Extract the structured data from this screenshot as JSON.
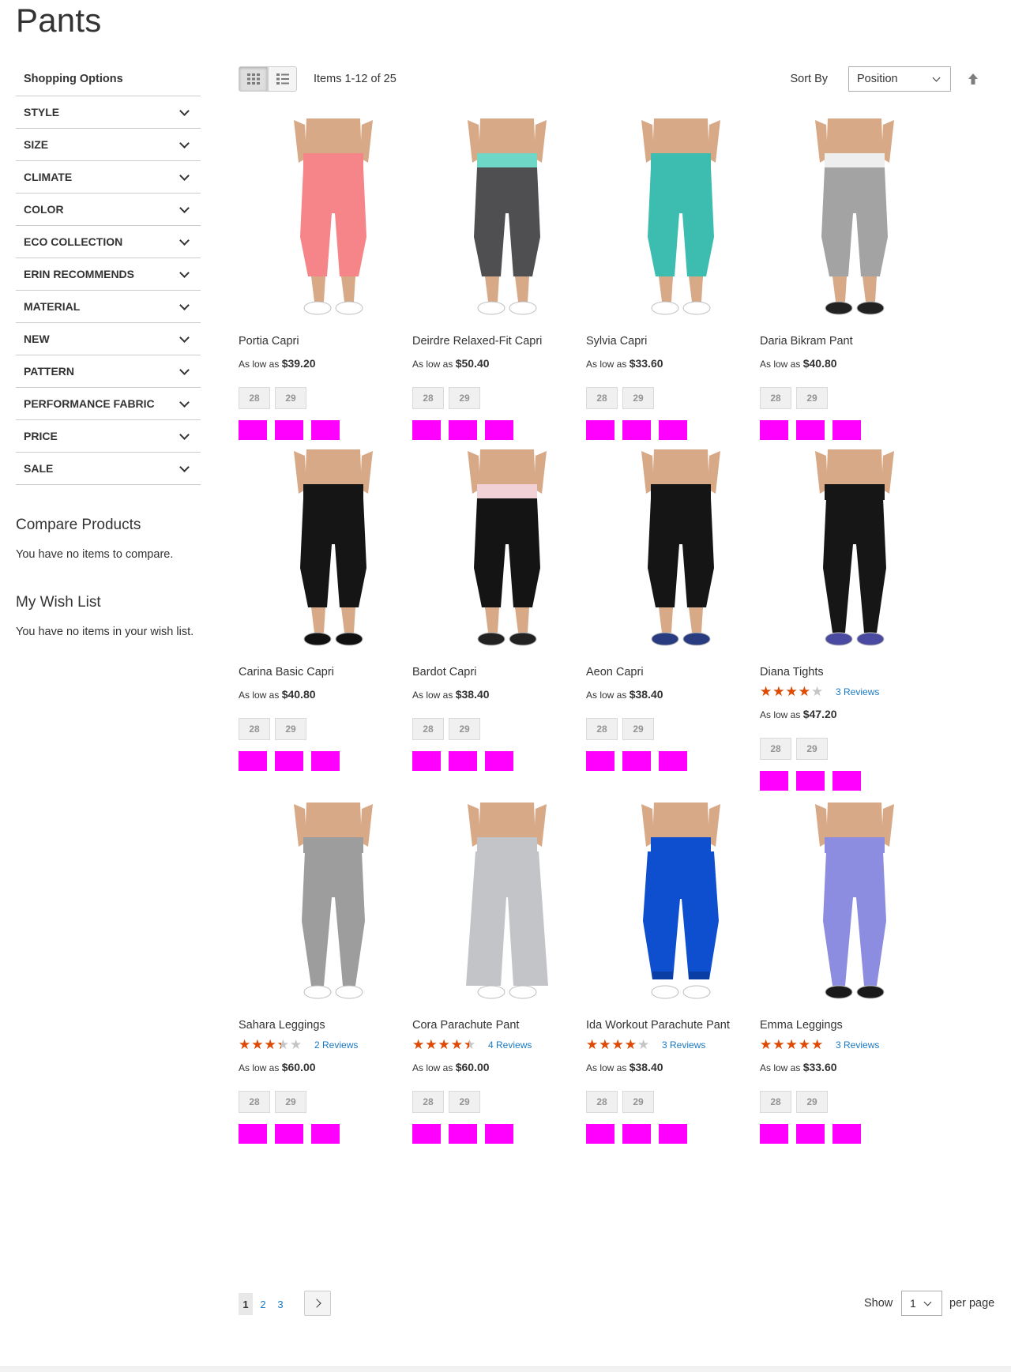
{
  "page_title": "Pants",
  "sidebar": {
    "title": "Shopping Options",
    "filters": [
      "STYLE",
      "SIZE",
      "CLIMATE",
      "COLOR",
      "ECO COLLECTION",
      "ERIN RECOMMENDS",
      "MATERIAL",
      "NEW",
      "PATTERN",
      "PERFORMANCE FABRIC",
      "PRICE",
      "SALE"
    ],
    "compare_title": "Compare Products",
    "compare_text": "You have no items to compare.",
    "wishlist_title": "My Wish List",
    "wishlist_text": "You have no items in your wish list."
  },
  "toolbar": {
    "amount": "Items 1-12 of 25",
    "sort_label": "Sort By",
    "sort_value": "Position"
  },
  "products": [
    {
      "name": "Portia Capri",
      "price_prefix": "As low as",
      "price": "$39.20",
      "sizes": [
        "28",
        "29"
      ],
      "pant": "#f6858a",
      "waist": "#f6858a",
      "shape": "capri",
      "shoe": "#ffffff"
    },
    {
      "name": "Deirdre Relaxed-Fit Capri",
      "price_prefix": "As low as",
      "price": "$50.40",
      "sizes": [
        "28",
        "29"
      ],
      "pant": "#4f4f52",
      "waist": "#6fd7c5",
      "shape": "capri",
      "shoe": "#ffffff"
    },
    {
      "name": "Sylvia Capri",
      "price_prefix": "As low as",
      "price": "$33.60",
      "sizes": [
        "28",
        "29"
      ],
      "pant": "#3cbdb0",
      "waist": "#3cbdb0",
      "shape": "capri",
      "shoe": "#ffffff"
    },
    {
      "name": "Daria Bikram Pant",
      "price_prefix": "As low as",
      "price": "$40.80",
      "sizes": [
        "28",
        "29"
      ],
      "pant": "#a3a3a3",
      "waist": "#eeeeee",
      "shape": "capri",
      "shoe": "#222222"
    },
    {
      "name": "Carina Basic Capri",
      "price_prefix": "As low as",
      "price": "$40.80",
      "sizes": [
        "28",
        "29"
      ],
      "pant": "#151515",
      "waist": "#151515",
      "shape": "capri",
      "shoe": "#111111"
    },
    {
      "name": "Bardot Capri",
      "price_prefix": "As low as",
      "price": "$38.40",
      "sizes": [
        "28",
        "29"
      ],
      "pant": "#141414",
      "waist": "#f1d0d6",
      "shape": "capri",
      "shoe": "#222222"
    },
    {
      "name": "Aeon Capri",
      "price_prefix": "As low as",
      "price": "$38.40",
      "sizes": [
        "28",
        "29"
      ],
      "pant": "#151515",
      "waist": "#151515",
      "shape": "capri",
      "shoe": "#2a3c80"
    },
    {
      "name": "Diana Tights",
      "rating": 3.5,
      "reviews": "3 Reviews",
      "price_prefix": "As low as",
      "price": "$47.20",
      "sizes": [
        "28",
        "29"
      ],
      "pant": "#161616",
      "waist": "#161616",
      "shape": "full",
      "shoe": "#4a4aa0"
    },
    {
      "name": "Sahara Leggings",
      "rating": 3,
      "reviews": "2 Reviews",
      "price_prefix": "As low as",
      "price": "$60.00",
      "sizes": [
        "28",
        "29"
      ],
      "pant": "#9d9d9d",
      "waist": "#9d9d9d",
      "shape": "full",
      "shoe": "#ffffff"
    },
    {
      "name": "Cora Parachute Pant",
      "rating": 4,
      "reviews": "4 Reviews",
      "price_prefix": "As low as",
      "price": "$60.00",
      "sizes": [
        "28",
        "29"
      ],
      "pant": "#c2c4c8",
      "waist": "#c2c4c8",
      "shape": "wide",
      "shoe": "#ffffff"
    },
    {
      "name": "Ida Workout Parachute Pant",
      "rating": 3.5,
      "reviews": "3 Reviews",
      "price_prefix": "As low as",
      "price": "$38.40",
      "sizes": [
        "28",
        "29"
      ],
      "pant": "#0e4fcf",
      "waist": "#0e4fcf",
      "shape": "jogger",
      "shoe": "#ffffff"
    },
    {
      "name": "Emma Leggings",
      "rating": 4.5,
      "reviews": "3 Reviews",
      "price_prefix": "As low as",
      "price": "$33.60",
      "sizes": [
        "28",
        "29"
      ],
      "pant": "#8c8de0",
      "waist": "#8c8de0",
      "shape": "full",
      "shoe": "#1a1a1a"
    }
  ],
  "pagination": {
    "pages": [
      "1",
      "2",
      "3"
    ],
    "current": "1",
    "limiter_label": "Show",
    "limiter_value": "1",
    "limiter_suffix": "per page"
  },
  "colors": {
    "swatch": "#ff00ff",
    "star": "#e04a00",
    "link": "#1979c3"
  }
}
